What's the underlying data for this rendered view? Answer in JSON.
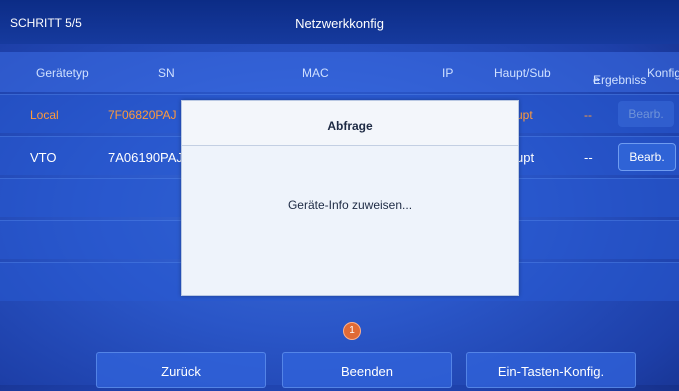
{
  "header": {
    "step": "SCHRITT 5/5",
    "title": "Netzwerkkonfig"
  },
  "table": {
    "columns": [
      "Gerätetyp",
      "SN",
      "MAC",
      "IP",
      "Haupt/Sub",
      "Ergebnisse",
      "Konfig"
    ],
    "result_header_lines": [
      "Ergebniss",
      "e"
    ],
    "rows": [
      {
        "type": "Local",
        "sn": "7F06820PAJ",
        "role": "upt",
        "result": "--",
        "action": "Bearb."
      },
      {
        "type": "VTO",
        "sn": "7A06190PAJ",
        "role": "upt",
        "result": "--",
        "action": "Bearb."
      }
    ]
  },
  "pager": {
    "current": "1"
  },
  "footer": {
    "back": "Zurück",
    "finish": "Beenden",
    "one_key": "Ein-Tasten-Konfig."
  },
  "dialog": {
    "title": "Abfrage",
    "message": "Geräte-Info zuweisen..."
  },
  "colors": {
    "local_row_text": "#ff9a3a",
    "pager": "#e06a36",
    "background": "#2a56c8"
  }
}
